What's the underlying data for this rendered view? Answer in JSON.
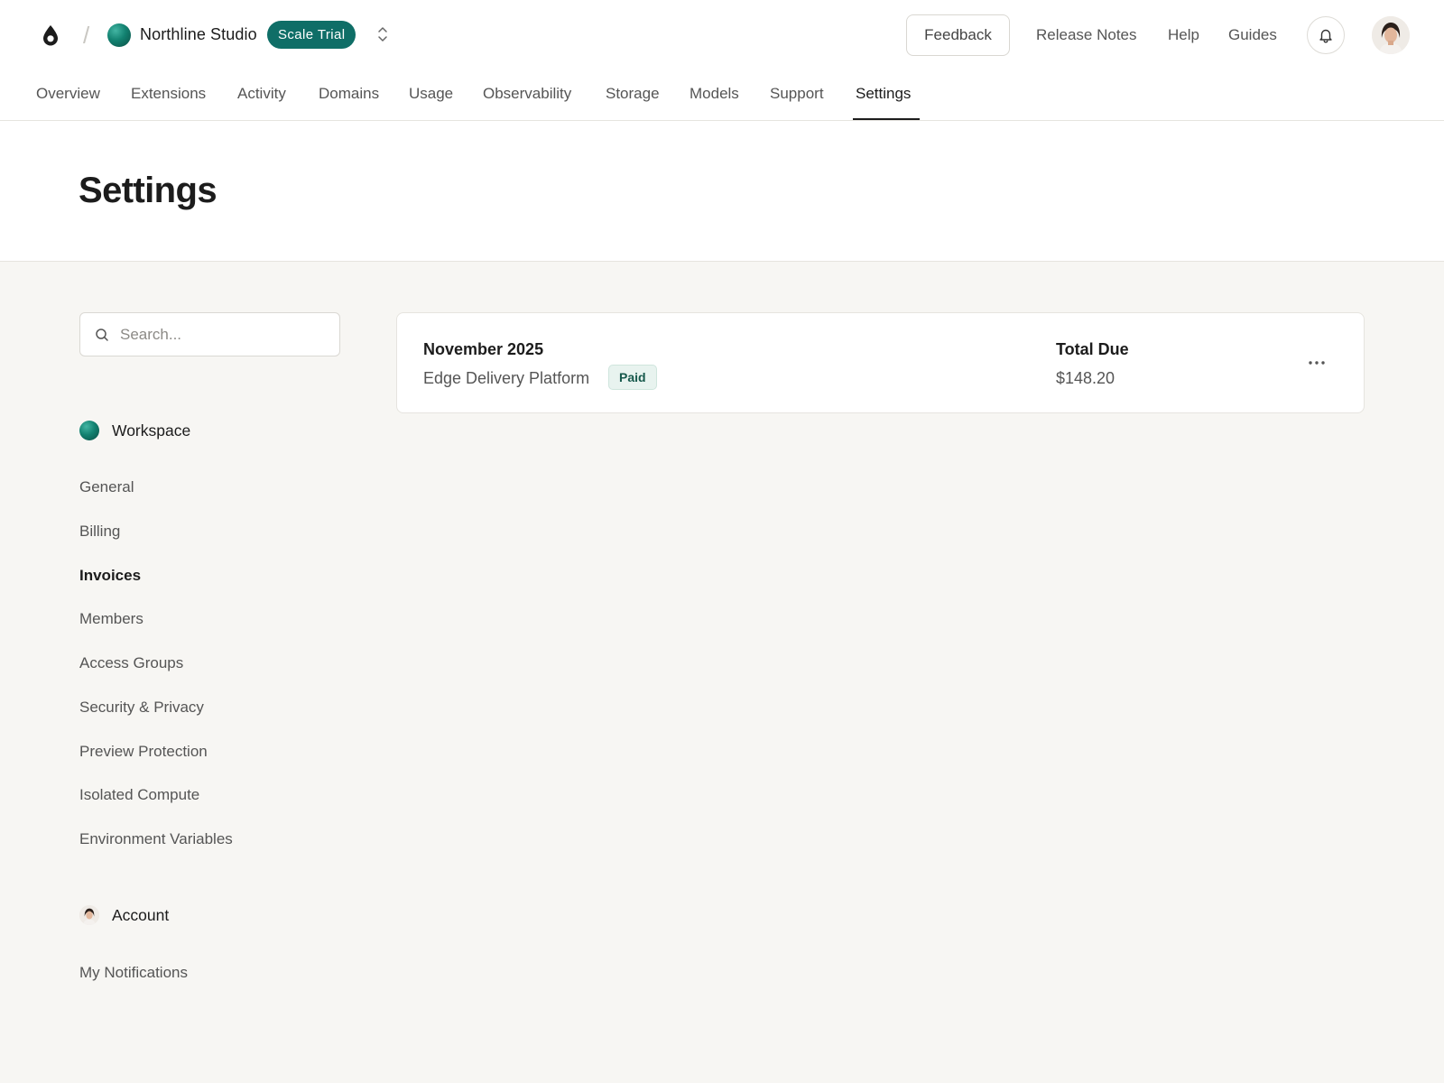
{
  "header": {
    "team_name": "Northline Studio",
    "plan_badge": "Scale Trial",
    "feedback_label": "Feedback",
    "links": [
      "Release Notes",
      "Help",
      "Guides"
    ]
  },
  "tabs": [
    {
      "label": "Overview"
    },
    {
      "label": "Extensions"
    },
    {
      "label": "Activity"
    },
    {
      "label": "Domains"
    },
    {
      "label": "Usage"
    },
    {
      "label": "Observability"
    },
    {
      "label": "Storage"
    },
    {
      "label": "Models"
    },
    {
      "label": "Support"
    },
    {
      "label": "Settings",
      "active": true
    }
  ],
  "page": {
    "title": "Settings"
  },
  "sidebar": {
    "search_placeholder": "Search...",
    "workspace_label": "Workspace",
    "workspace_items": [
      {
        "label": "General"
      },
      {
        "label": "Billing"
      },
      {
        "label": "Invoices",
        "active": true
      },
      {
        "label": "Members"
      },
      {
        "label": "Access Groups"
      },
      {
        "label": "Security & Privacy"
      },
      {
        "label": "Preview Protection"
      },
      {
        "label": "Isolated Compute"
      },
      {
        "label": "Environment Variables"
      }
    ],
    "account_label": "Account",
    "account_items": [
      {
        "label": "My Notifications"
      }
    ]
  },
  "invoice": {
    "period": "November 2025",
    "project": "Edge Delivery Platform",
    "status": "Paid",
    "total_label": "Total Due",
    "total_value": "$148.20"
  },
  "colors": {
    "accent": "#0f6e67",
    "page_bg": "#f7f6f3",
    "status_paid_bg": "#e8f3ef"
  },
  "icons": {
    "logo": "droplet-logo-icon",
    "switcher": "chevron-up-down-icon",
    "notifications": "bell-icon",
    "search": "search-icon",
    "more": "more-horizontal-icon"
  }
}
